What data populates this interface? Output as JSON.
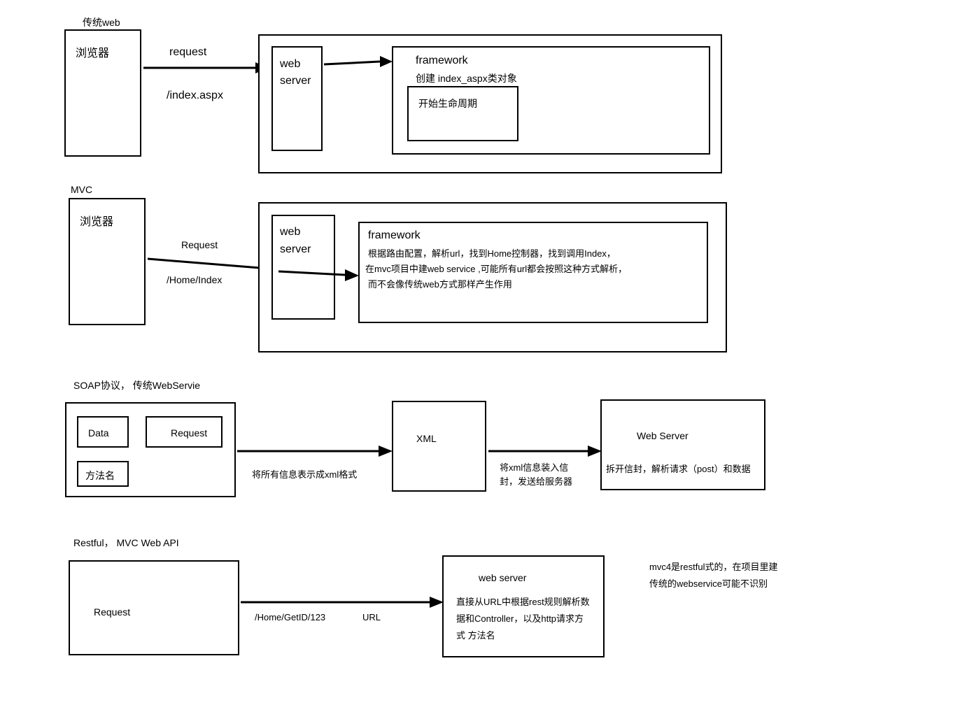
{
  "section1": {
    "title": "传统web",
    "browser": "浏览器",
    "request": "request",
    "path": "/index.aspx",
    "webServerL1": "web",
    "webServerL2": "server",
    "frameworkTitle": "framework",
    "frameworkSub": "创建 index_aspx类对象",
    "lifecycle": "开始生命周期"
  },
  "section2": {
    "title": "MVC",
    "browser": "浏览器",
    "request": "Request",
    "path": "/Home/Index",
    "webServerL1": "web",
    "webServerL2": "server",
    "frameworkTitle": "framework",
    "frameworkLine1": "根据路由配置，解析url，找到Home控制器，找到调用Index，",
    "frameworkLine2": "在mvc项目中建web service ,可能所有url都会按照这种方式解析，",
    "frameworkLine3": "而不会像传统web方式那样产生作用"
  },
  "section3": {
    "title": "SOAP协议， 传统WebServie",
    "data": "Data",
    "request": "Request",
    "methodName": "方法名",
    "note1": "将所有信息表示成xml格式",
    "xml": "XML",
    "note2a": "将xml信息装入信",
    "note2b": "封，发送给服务器",
    "webServer": "Web Server",
    "note3": "拆开信封，解析请求（post）和数据"
  },
  "section4": {
    "title": "Restful， MVC Web API",
    "request": "Request",
    "path": "/Home/GetID/123",
    "pathLabel": "URL",
    "webServer": "web server",
    "wsLine1": "直接从URL中根据rest规则解析数",
    "wsLine2": "据和Controller，以及http请求方",
    "wsLine3": "式     方法名",
    "noteA": "mvc4是restful式的，在项目里建",
    "noteB": "传统的webservice可能不识别"
  }
}
